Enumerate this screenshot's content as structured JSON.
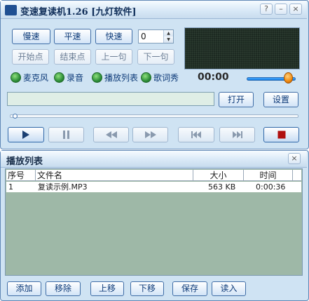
{
  "main_window": {
    "title": "变速复读机1.26 [九灯软件]",
    "title_buttons": {
      "help": "?",
      "minimize": "–",
      "close": "×"
    },
    "speed_buttons": [
      "慢速",
      "平速",
      "快速"
    ],
    "speed_value": "0",
    "segment_buttons": [
      "开始点",
      "结束点",
      "上一句",
      "下一句"
    ],
    "toggles": [
      "麦克风",
      "录音",
      "播放列表",
      "歌词秀"
    ],
    "time": "00:00",
    "volume_fraction": 0.85,
    "progress_fraction": 0.0,
    "file_path": "",
    "open_button": "打开",
    "settings_button": "设置",
    "transport_icons": [
      "play-icon",
      "pause-icon",
      "rewind-icon",
      "fast-forward-icon",
      "previous-icon",
      "next-icon",
      "stop-icon"
    ]
  },
  "playlist": {
    "title": "播放列表",
    "close": "×",
    "columns": [
      "序号",
      "文件名",
      "大小",
      "时间"
    ],
    "rows": [
      {
        "index": "1",
        "name": "复读示例.MP3",
        "size": "563 KB",
        "time": "0:00:36"
      }
    ],
    "buttons": [
      "添加",
      "移除",
      "上移",
      "下移",
      "保存",
      "读入"
    ]
  },
  "colors": {
    "window_bg": "#cfe3f3",
    "button_text": "#0d3a78",
    "list_bg": "#9eb8a7",
    "lcd_bg": "#1d2a22",
    "volume_fill": "#157be0",
    "stop_red": "#b01010"
  }
}
